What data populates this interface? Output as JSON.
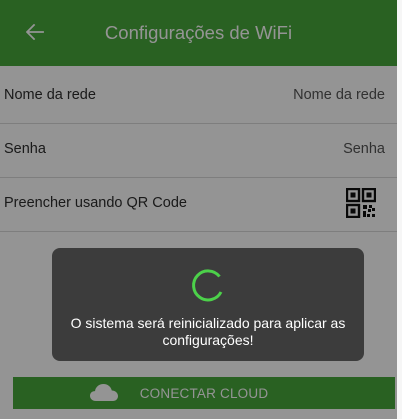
{
  "appbar": {
    "title": "Configurações de WiFi",
    "back_icon": "arrow-left-icon"
  },
  "rows": [
    {
      "label": "Nome da rede",
      "value": "Nome da rede"
    },
    {
      "label": "Senha",
      "value": "Senha"
    },
    {
      "label": "Preencher usando QR Code",
      "icon": "qr-code-icon"
    }
  ],
  "connect_button": {
    "label": "CONECTAR CLOUD",
    "icon": "cloud-icon"
  },
  "dialog": {
    "message": "O sistema será reinicializado para aplicar as configurações!",
    "spinner_icon": "loading-spinner-icon"
  },
  "colors": {
    "primary": "#47a73b",
    "spinner": "#4cd14a",
    "dialog_bg": "#3c3c3c",
    "overlay": "rgba(0,0,0,0.42)"
  }
}
